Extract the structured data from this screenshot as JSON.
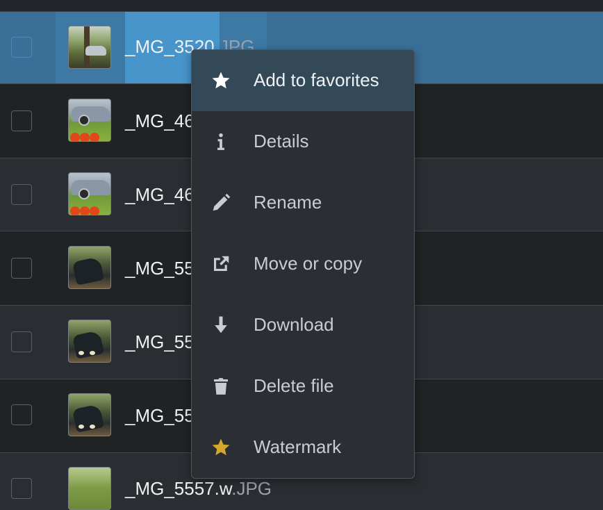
{
  "files": [
    {
      "name": "_MG_3520",
      "ext": ".JPG",
      "selected": true,
      "thumbnail": "forest-car-photo"
    },
    {
      "name": "_MG_46",
      "ext": "",
      "selected": false,
      "thumbnail": "car-pumpkins-photo"
    },
    {
      "name": "_MG_46",
      "ext": "",
      "selected": false,
      "thumbnail": "car-pumpkins-photo"
    },
    {
      "name": "_MG_55",
      "ext": "",
      "selected": false,
      "thumbnail": "dark-car-woods-photo"
    },
    {
      "name": "_MG_55",
      "ext": "",
      "selected": false,
      "thumbnail": "dark-car-woods-photo"
    },
    {
      "name": "_MG_55",
      "ext": "",
      "selected": false,
      "thumbnail": "dark-car-woods-photo"
    },
    {
      "name": "_MG_5557.w",
      "ext": ".JPG",
      "selected": false,
      "thumbnail": "park-photo"
    }
  ],
  "context_menu": {
    "items": [
      {
        "label": "Add to favorites",
        "icon": "star-icon",
        "active": true
      },
      {
        "label": "Details",
        "icon": "info-icon",
        "active": false
      },
      {
        "label": "Rename",
        "icon": "pencil-icon",
        "active": false
      },
      {
        "label": "Move or copy",
        "icon": "external-link-icon",
        "active": false
      },
      {
        "label": "Download",
        "icon": "download-arrow-icon",
        "active": false
      },
      {
        "label": "Delete file",
        "icon": "trash-icon",
        "active": false
      },
      {
        "label": "Watermark",
        "icon": "gold-star-icon",
        "active": false
      }
    ]
  },
  "colors": {
    "selected_row": "#3a7098",
    "menu_active": "#334958",
    "watermark_star": "#d4a72c"
  }
}
